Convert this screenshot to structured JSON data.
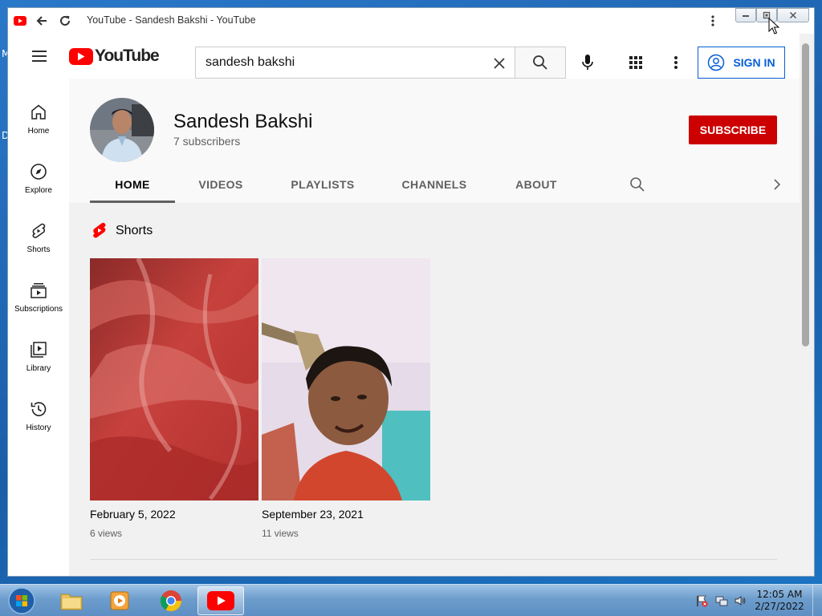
{
  "desktop": {
    "edge_letter_1": "M",
    "edge_letter_2": "D"
  },
  "browser": {
    "window_title": "YouTube - Sandesh Bakshi - YouTube",
    "app_icon": "youtube-icon",
    "back_icon": "back-arrow-icon",
    "reload_icon": "reload-icon",
    "menu_icon": "vertical-dots-icon",
    "window_controls": [
      "minimize",
      "restore",
      "close"
    ]
  },
  "header": {
    "logo_text": "YouTube",
    "search": {
      "value": "sandesh bakshi",
      "placeholder": "Search"
    },
    "signin_label": "SIGN IN"
  },
  "sidebar": {
    "items": [
      {
        "label": "Home",
        "icon": "home-icon"
      },
      {
        "label": "Explore",
        "icon": "compass-icon"
      },
      {
        "label": "Shorts",
        "icon": "shorts-icon"
      },
      {
        "label": "Subscriptions",
        "icon": "subscriptions-icon"
      },
      {
        "label": "Library",
        "icon": "library-icon"
      },
      {
        "label": "History",
        "icon": "history-icon"
      }
    ]
  },
  "channel": {
    "name": "Sandesh Bakshi",
    "subscribers": "7 subscribers",
    "subscribe_label": "SUBSCRIBE",
    "tabs": [
      {
        "label": "HOME",
        "active": true
      },
      {
        "label": "VIDEOS",
        "active": false
      },
      {
        "label": "PLAYLISTS",
        "active": false
      },
      {
        "label": "CHANNELS",
        "active": false
      },
      {
        "label": "ABOUT",
        "active": false
      }
    ]
  },
  "shorts": {
    "section_title": "Shorts",
    "items": [
      {
        "date": "February 5, 2022",
        "views": "6 views"
      },
      {
        "date": "September 23, 2021",
        "views": "11 views"
      }
    ]
  },
  "taskbar": {
    "apps": [
      "start-orb",
      "file-explorer",
      "media-player",
      "chrome",
      "youtube"
    ],
    "active_app": "youtube",
    "clock_time": "12:05 AM",
    "clock_date": "2/27/2022"
  },
  "colors": {
    "youtube_red": "#ff0000",
    "subscribe_red": "#cc0000",
    "signin_blue": "#065fd4",
    "page_bg": "#f9f9f9"
  }
}
